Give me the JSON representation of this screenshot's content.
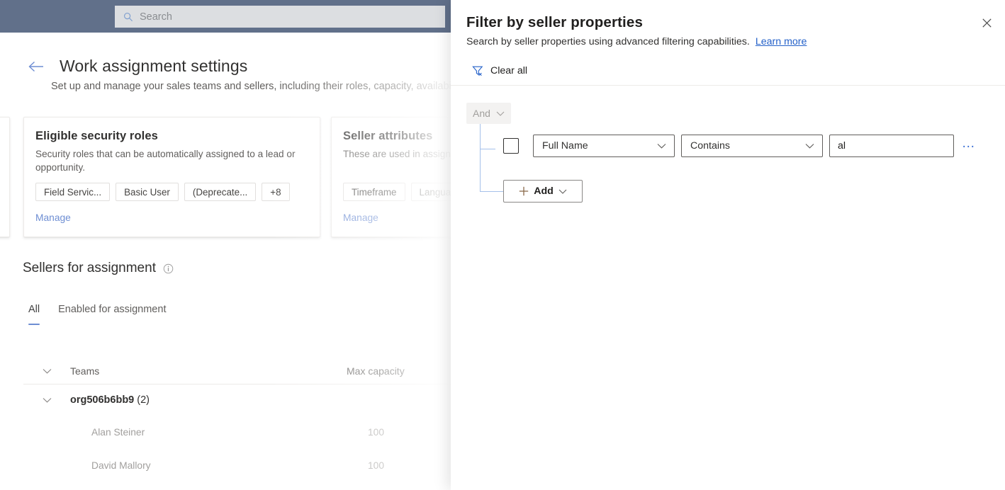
{
  "app": {
    "search": {
      "placeholder": "Search",
      "icon": "search-icon"
    },
    "page": {
      "title": "Work assignment settings",
      "subtitle": "Set up and manage your sales teams and sellers, including their roles, capacity, availability a",
      "back_icon": "back-arrow-icon"
    },
    "cards": [
      {
        "title": "Eligible security roles",
        "description": "Security roles that can be automatically assigned to a lead or opportunity.",
        "chips": [
          "Field Servic...",
          "Basic User",
          "(Deprecate...",
          "+8"
        ],
        "manage_label": "Manage"
      },
      {
        "title": "Seller attributes",
        "description": "These are used in assignm",
        "chips": [
          "Timeframe",
          "Langua"
        ],
        "manage_label": "Manage"
      }
    ],
    "sellers_section": {
      "title": "Sellers for assignment",
      "info_icon": "info-icon",
      "tabs": [
        {
          "label": "All",
          "active": true
        },
        {
          "label": "Enabled for assignment",
          "active": false
        }
      ],
      "table": {
        "columns": [
          "Teams",
          "Max capacity"
        ],
        "group": {
          "name": "org506b6bb9",
          "count": "(2)"
        },
        "rows": [
          {
            "name": "Alan Steiner",
            "max_capacity": "100"
          },
          {
            "name": "David Mallory",
            "max_capacity": "100"
          }
        ]
      }
    }
  },
  "panel": {
    "title": "Filter by seller properties",
    "description": "Search by seller properties using advanced filtering capabilities.",
    "learn_more": "Learn more",
    "close_icon": "close-icon",
    "clear_all": {
      "label": "Clear all",
      "icon": "filter-clear-icon"
    },
    "builder": {
      "logical_operator": {
        "label": "And",
        "icon": "chevron-down-icon"
      },
      "condition": {
        "field": "Full Name",
        "operator": "Contains",
        "value": "al",
        "value_placeholder": "",
        "more_label": "…"
      },
      "add_button": {
        "label": "Add",
        "icon": "plus-icon"
      }
    }
  },
  "colors": {
    "topbar": "#61708a",
    "accent_link": "#2461c9",
    "tab_underline": "#6e8ed3",
    "tree_line": "#a5c0ea",
    "more_dots": "#3b6fd4"
  }
}
